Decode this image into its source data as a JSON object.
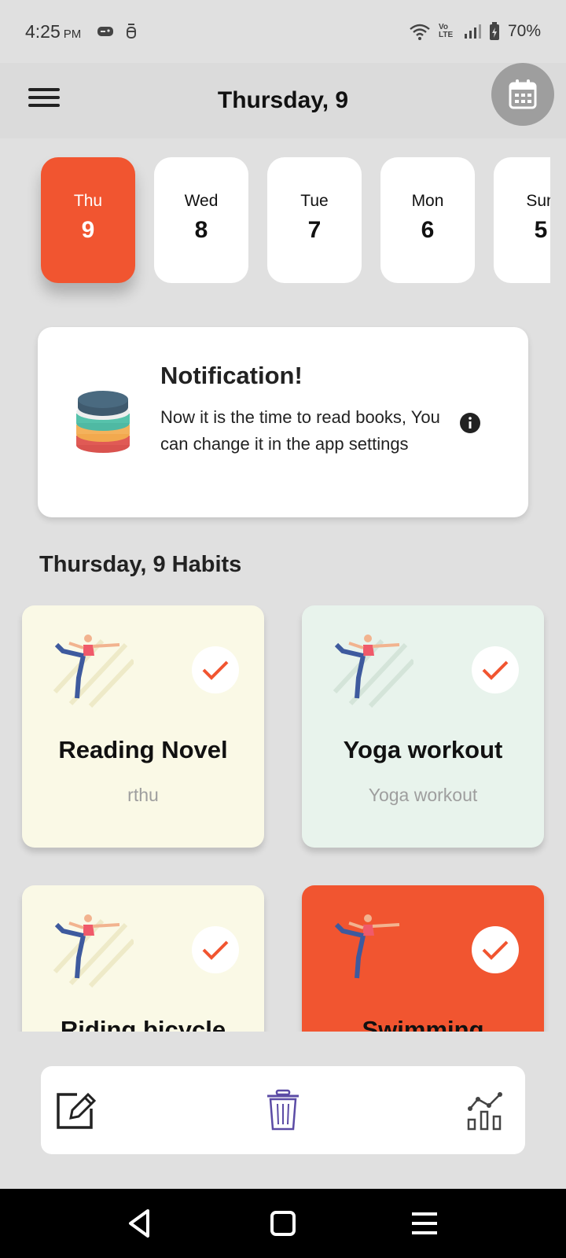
{
  "status_bar": {
    "time": "4:25",
    "ampm": "PM",
    "network": "Vo LTE",
    "battery": "70%"
  },
  "header": {
    "title": "Thursday, 9"
  },
  "days": [
    {
      "name": "Thu",
      "num": "9",
      "selected": true
    },
    {
      "name": "Wed",
      "num": "8",
      "selected": false
    },
    {
      "name": "Tue",
      "num": "7",
      "selected": false
    },
    {
      "name": "Mon",
      "num": "6",
      "selected": false
    },
    {
      "name": "Sun",
      "num": "5",
      "selected": false
    }
  ],
  "notification": {
    "title": "Notification!",
    "body": "Now it is the time to read books, You can change it in the app settings"
  },
  "habits_title": "Thursday, 9 Habits",
  "habits": [
    {
      "name": "Reading Novel",
      "desc": "rthu",
      "bg": "#faf9e6",
      "completed": true
    },
    {
      "name": "Yoga workout",
      "desc": "Yoga workout",
      "bg": "#e8f3ec",
      "completed": true
    },
    {
      "name": "Riding bicycle",
      "desc": "",
      "bg": "#faf9e6",
      "completed": true
    },
    {
      "name": "Swimming",
      "desc": "",
      "bg": "#f15530",
      "completed": true
    }
  ],
  "colors": {
    "accent": "#f15530",
    "background": "#e0e0e0",
    "card": "#ffffff",
    "trash_icon": "#5b4ba5"
  },
  "toolbar": {
    "edit": "edit-icon",
    "delete": "trash-icon",
    "stats": "stats-chart-icon"
  }
}
